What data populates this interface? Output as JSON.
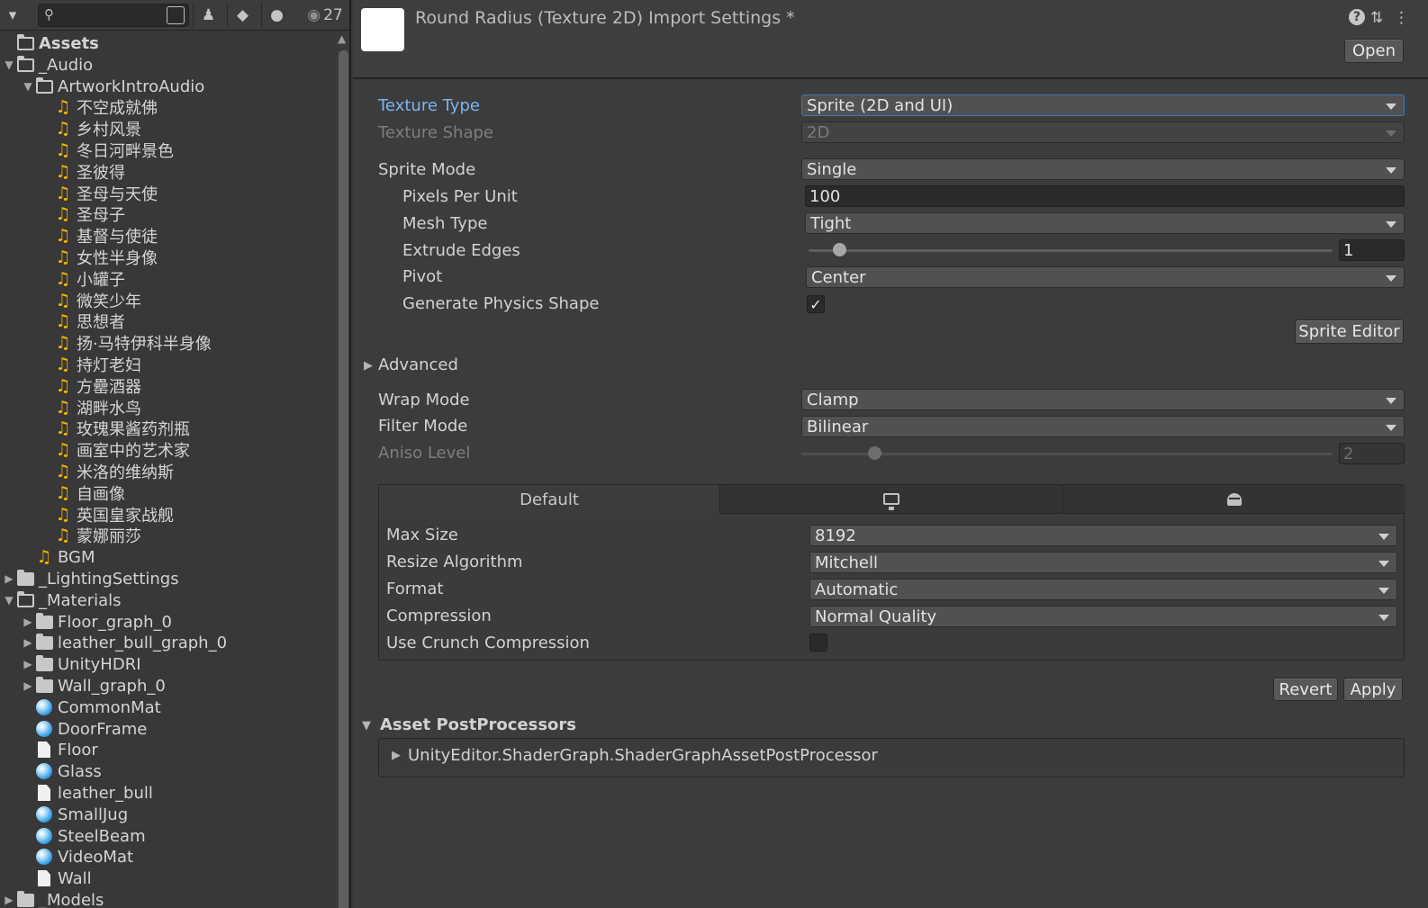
{
  "project": {
    "hidden_count": "27",
    "search": {
      "value": ""
    },
    "tree": [
      {
        "label": "Assets",
        "kind": "folder-open",
        "depth": 0,
        "arrow": "",
        "bold": true
      },
      {
        "label": "_Audio",
        "kind": "folder-open",
        "depth": 0,
        "arrow": "▼"
      },
      {
        "label": "ArtworkIntroAudio",
        "kind": "folder-open",
        "depth": 1,
        "arrow": "▼"
      },
      {
        "label": "不空成就佛",
        "kind": "audio",
        "depth": 2
      },
      {
        "label": "乡村风景",
        "kind": "audio",
        "depth": 2
      },
      {
        "label": "冬日河畔景色",
        "kind": "audio",
        "depth": 2
      },
      {
        "label": "圣彼得",
        "kind": "audio",
        "depth": 2
      },
      {
        "label": "圣母与天使",
        "kind": "audio",
        "depth": 2
      },
      {
        "label": "圣母子",
        "kind": "audio",
        "depth": 2
      },
      {
        "label": "基督与使徒",
        "kind": "audio",
        "depth": 2
      },
      {
        "label": "女性半身像",
        "kind": "audio",
        "depth": 2
      },
      {
        "label": "小罐子",
        "kind": "audio",
        "depth": 2
      },
      {
        "label": "微笑少年",
        "kind": "audio",
        "depth": 2
      },
      {
        "label": "思想者",
        "kind": "audio",
        "depth": 2
      },
      {
        "label": "扬·马特伊科半身像",
        "kind": "audio",
        "depth": 2
      },
      {
        "label": "持灯老妇",
        "kind": "audio",
        "depth": 2
      },
      {
        "label": "方罍酒器",
        "kind": "audio",
        "depth": 2
      },
      {
        "label": "湖畔水鸟",
        "kind": "audio",
        "depth": 2
      },
      {
        "label": "玫瑰果酱药剂瓶",
        "kind": "audio",
        "depth": 2
      },
      {
        "label": "画室中的艺术家",
        "kind": "audio",
        "depth": 2
      },
      {
        "label": "米洛的维纳斯",
        "kind": "audio",
        "depth": 2
      },
      {
        "label": "自画像",
        "kind": "audio",
        "depth": 2
      },
      {
        "label": "英国皇家战舰",
        "kind": "audio",
        "depth": 2
      },
      {
        "label": "蒙娜丽莎",
        "kind": "audio",
        "depth": 2
      },
      {
        "label": "BGM",
        "kind": "audio",
        "depth": 1
      },
      {
        "label": "_LightingSettings",
        "kind": "folder",
        "depth": 0,
        "arrow": "▶"
      },
      {
        "label": "_Materials",
        "kind": "folder-open",
        "depth": 0,
        "arrow": "▼"
      },
      {
        "label": "Floor_graph_0",
        "kind": "folder",
        "depth": 1,
        "arrow": "▶"
      },
      {
        "label": "leather_bull_graph_0",
        "kind": "folder",
        "depth": 1,
        "arrow": "▶"
      },
      {
        "label": "UnityHDRI",
        "kind": "folder",
        "depth": 1,
        "arrow": "▶"
      },
      {
        "label": "Wall_graph_0",
        "kind": "folder",
        "depth": 1,
        "arrow": "▶"
      },
      {
        "label": "CommonMat",
        "kind": "material",
        "depth": 1
      },
      {
        "label": "DoorFrame",
        "kind": "material",
        "depth": 1
      },
      {
        "label": "Floor",
        "kind": "file",
        "depth": 1
      },
      {
        "label": "Glass",
        "kind": "material",
        "depth": 1
      },
      {
        "label": "leather_bull",
        "kind": "file",
        "depth": 1
      },
      {
        "label": "SmallJug",
        "kind": "material",
        "depth": 1
      },
      {
        "label": "SteelBeam",
        "kind": "material",
        "depth": 1
      },
      {
        "label": "VideoMat",
        "kind": "material",
        "depth": 1
      },
      {
        "label": "Wall",
        "kind": "file",
        "depth": 1
      },
      {
        "label": "_Models",
        "kind": "folder",
        "depth": 0,
        "arrow": "▶"
      }
    ]
  },
  "inspector": {
    "title": "Round Radius (Texture 2D) Import Settings *",
    "open_label": "Open",
    "texture_type": {
      "label": "Texture Type",
      "value": "Sprite (2D and UI)"
    },
    "texture_shape": {
      "label": "Texture Shape",
      "value": "2D"
    },
    "sprite_mode": {
      "label": "Sprite Mode",
      "value": "Single"
    },
    "pixels_per_unit": {
      "label": "Pixels Per Unit",
      "value": "100"
    },
    "mesh_type": {
      "label": "Mesh Type",
      "value": "Tight"
    },
    "extrude_edges": {
      "label": "Extrude Edges",
      "value": "1",
      "min": 0,
      "max": 32
    },
    "pivot": {
      "label": "Pivot",
      "value": "Center"
    },
    "generate_physics_shape": {
      "label": "Generate Physics Shape",
      "checked": true,
      "mark": "✓"
    },
    "sprite_editor_label": "Sprite Editor",
    "advanced_label": "Advanced",
    "wrap_mode": {
      "label": "Wrap Mode",
      "value": "Clamp"
    },
    "filter_mode": {
      "label": "Filter Mode",
      "value": "Bilinear"
    },
    "aniso_level": {
      "label": "Aniso Level",
      "value": "2",
      "min": 0,
      "max": 16
    },
    "platform_tabs": {
      "default_label": "Default",
      "standalone_icon": "monitor-icon",
      "android_icon": "android-icon"
    },
    "max_size": {
      "label": "Max Size",
      "value": "8192"
    },
    "resize_algorithm": {
      "label": "Resize Algorithm",
      "value": "Mitchell"
    },
    "format": {
      "label": "Format",
      "value": "Automatic"
    },
    "compression": {
      "label": "Compression",
      "value": "Normal Quality"
    },
    "use_crunch": {
      "label": "Use Crunch Compression",
      "checked": false
    },
    "revert_label": "Revert",
    "apply_label": "Apply",
    "postprocessors": {
      "label": "Asset PostProcessors",
      "item": "UnityEditor.ShaderGraph.ShaderGraphAssetPostProcessor"
    }
  },
  "colors": {
    "accent_label": "#7cb4f2",
    "focus_border": "#3a79bb",
    "audio_icon": "#f7b500",
    "material_icon": "#2b9ae3"
  }
}
